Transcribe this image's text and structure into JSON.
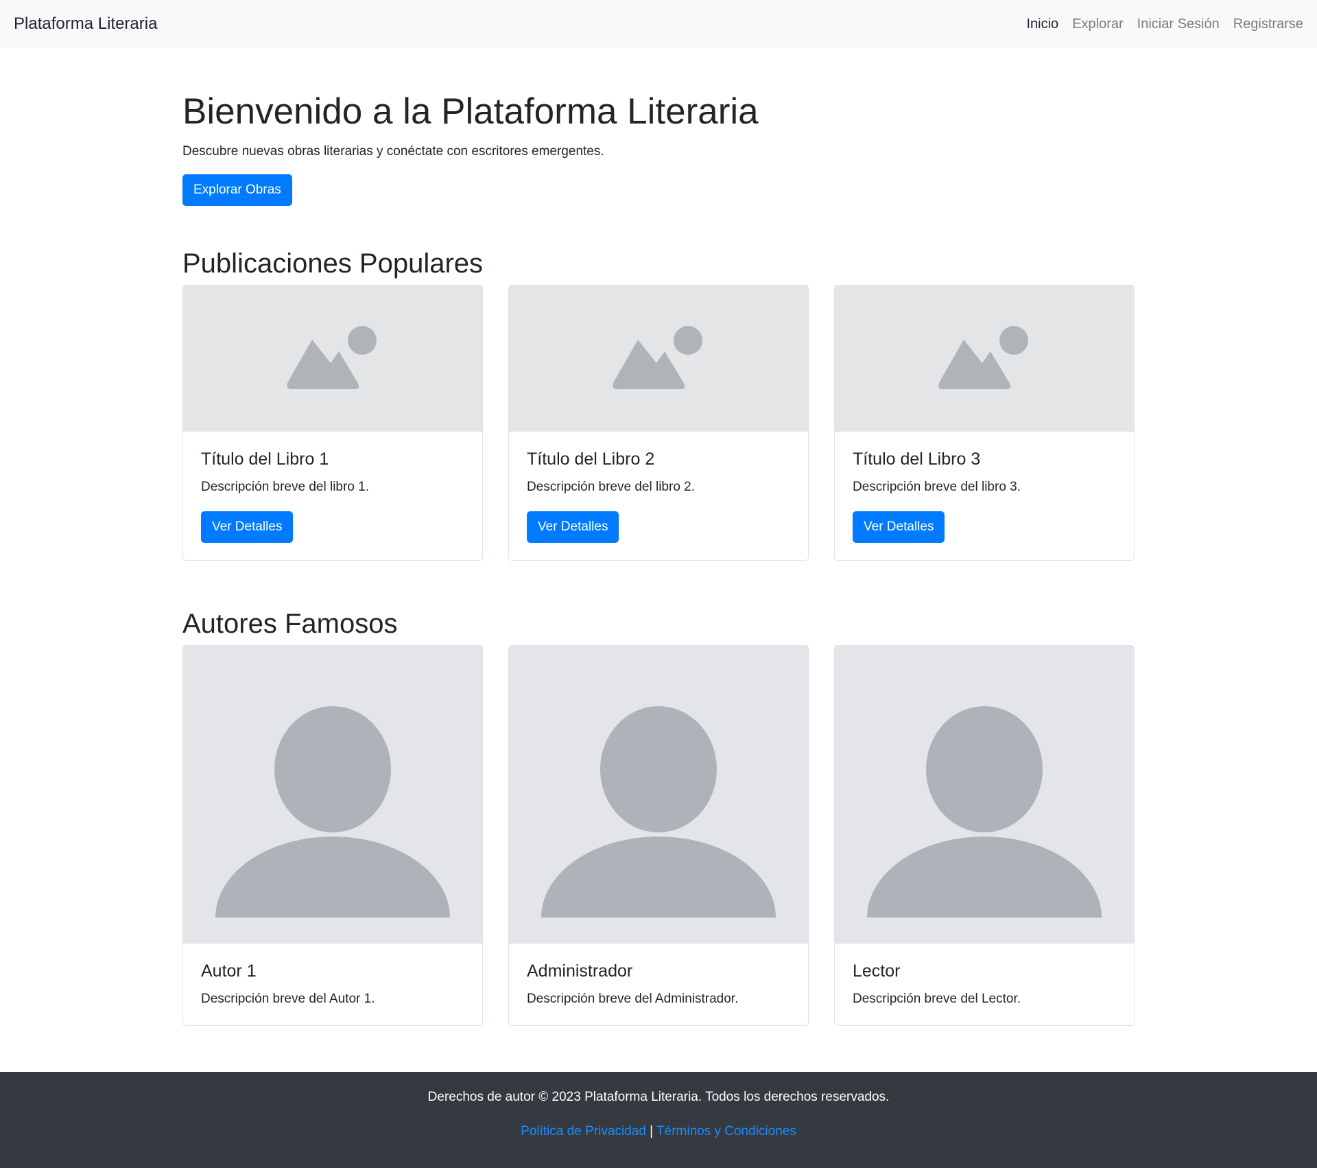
{
  "navbar": {
    "brand": "Plataforma Literaria",
    "links": [
      "Inicio",
      "Explorar",
      "Iniciar Sesión",
      "Registrarse"
    ]
  },
  "hero": {
    "title": "Bienvenido a la Plataforma Literaria",
    "lead": "Descubre nuevas obras literarias y conéctate con escritores emergentes.",
    "button": "Explorar Obras"
  },
  "books": {
    "heading": "Publicaciones Populares",
    "items": [
      {
        "title": "Título del Libro 1",
        "description": "Descripción breve del libro 1.",
        "button": "Ver Detalles"
      },
      {
        "title": "Título del Libro 2",
        "description": "Descripción breve del libro 2.",
        "button": "Ver Detalles"
      },
      {
        "title": "Título del Libro 3",
        "description": "Descripción breve del libro 3.",
        "button": "Ver Detalles"
      }
    ]
  },
  "authors": {
    "heading": "Autores Famosos",
    "items": [
      {
        "name": "Autor 1",
        "description": "Descripción breve del Autor 1."
      },
      {
        "name": "Administrador",
        "description": "Descripción breve del Administrador."
      },
      {
        "name": "Lector",
        "description": "Descripción breve del Lector."
      }
    ]
  },
  "footer": {
    "copyright": "Derechos de autor © 2023 Plataforma Literaria. Todos los derechos reservados.",
    "privacy": "Política de Privacidad",
    "separator": "|",
    "terms": "Términos y Condiciones"
  },
  "colors": {
    "primary": "#007bff",
    "navbar_bg": "#f8f9fa",
    "footer_bg": "#343a40",
    "placeholder_bg": "#e4e5e7",
    "placeholder_icon": "#b0b4b8"
  }
}
